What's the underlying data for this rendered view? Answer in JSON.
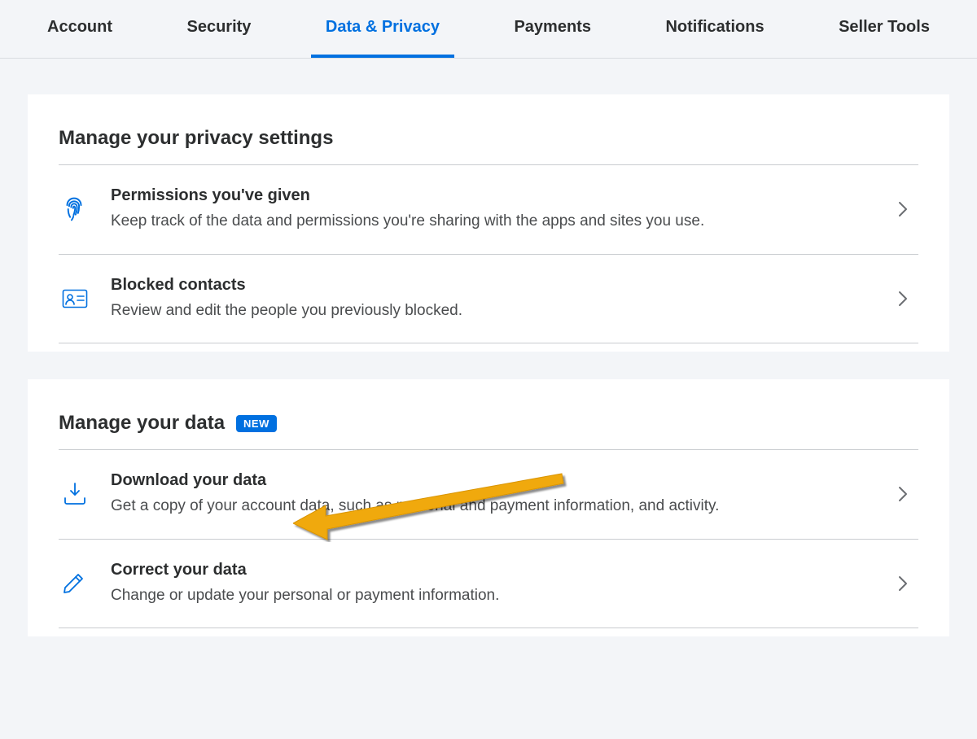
{
  "tabs": [
    {
      "label": "Account"
    },
    {
      "label": "Security"
    },
    {
      "label": "Data & Privacy",
      "active": true
    },
    {
      "label": "Payments"
    },
    {
      "label": "Notifications"
    },
    {
      "label": "Seller Tools"
    }
  ],
  "section1": {
    "title": "Manage your privacy settings",
    "rows": [
      {
        "title": "Permissions you've given",
        "desc": "Keep track of the data and permissions you're sharing with the apps and sites you use."
      },
      {
        "title": "Blocked contacts",
        "desc": "Review and edit the people you previously blocked."
      }
    ]
  },
  "section2": {
    "title": "Manage your data",
    "badge": "NEW",
    "rows": [
      {
        "title": "Download your data",
        "desc": "Get a copy of your account data, such as personal and payment information, and activity."
      },
      {
        "title": "Correct your data",
        "desc": "Change or update your personal or payment information."
      }
    ]
  }
}
